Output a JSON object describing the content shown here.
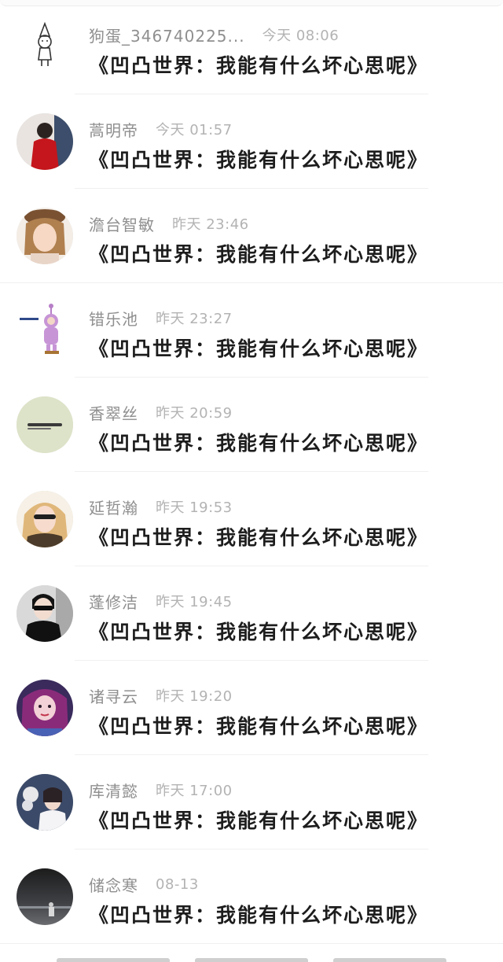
{
  "comments": [
    {
      "name": "狗蛋_346740225...",
      "time": "今天 08:06",
      "message": "《凹凸世界：我能有什么坏心思呢》",
      "avatar": "doodle-avatar"
    },
    {
      "name": "蒿明帝",
      "time": "今天 01:57",
      "message": "《凹凸世界：我能有什么坏心思呢》",
      "avatar": "red-coat-avatar"
    },
    {
      "name": "澹台智敏",
      "time": "昨天 23:46",
      "message": "《凹凸世界：我能有什么坏心思呢》",
      "avatar": "girl-hat-avatar"
    },
    {
      "name": "错乐池",
      "time": "昨天 23:27",
      "message": "《凹凸世界：我能有什么坏心思呢》",
      "avatar": "teletubby-avatar"
    },
    {
      "name": "香翠丝",
      "time": "昨天 20:59",
      "message": "《凹凸世界：我能有什么坏心思呢》",
      "avatar": "text-circle-avatar"
    },
    {
      "name": "延哲瀚",
      "time": "昨天 19:53",
      "message": "《凹凸世界：我能有什么坏心思呢》",
      "avatar": "blonde-girl-avatar"
    },
    {
      "name": "蓬修洁",
      "time": "昨天 19:45",
      "message": "《凹凸世界：我能有什么坏心思呢》",
      "avatar": "sunglasses-avatar"
    },
    {
      "name": "诸寻云",
      "time": "昨天 19:20",
      "message": "《凹凸世界：我能有什么坏心思呢》",
      "avatar": "purple-hair-avatar"
    },
    {
      "name": "库清懿",
      "time": "昨天 17:00",
      "message": "《凹凸世界：我能有什么坏心思呢》",
      "avatar": "flower-girl-avatar"
    },
    {
      "name": "储念寒",
      "time": "08-13",
      "message": "《凹凸世界：我能有什么坏心思呢》",
      "avatar": "night-sky-avatar"
    }
  ]
}
